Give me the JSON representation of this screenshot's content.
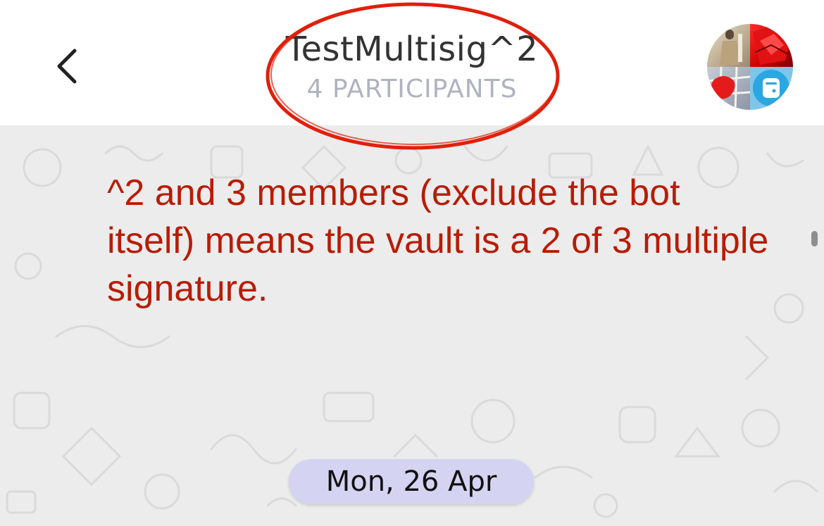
{
  "header": {
    "title": "TestMultisig^2",
    "subtitle": "4 PARTICIPANTS",
    "back_icon": "chevron-left-icon",
    "avatar_icon": "group-avatar"
  },
  "annotation": {
    "text": "^2 and 3 members (exclude the bot itself) means the vault is a 2 of 3 multiple signature.",
    "color": "#b81c06"
  },
  "chat": {
    "date_label": "Mon, 26 Apr"
  },
  "colors": {
    "title_text": "#333333",
    "subtitle_text": "#aeb3c0",
    "chat_background": "#ececec",
    "date_pill": "#d4d4f2",
    "ring": "#e0200a"
  }
}
